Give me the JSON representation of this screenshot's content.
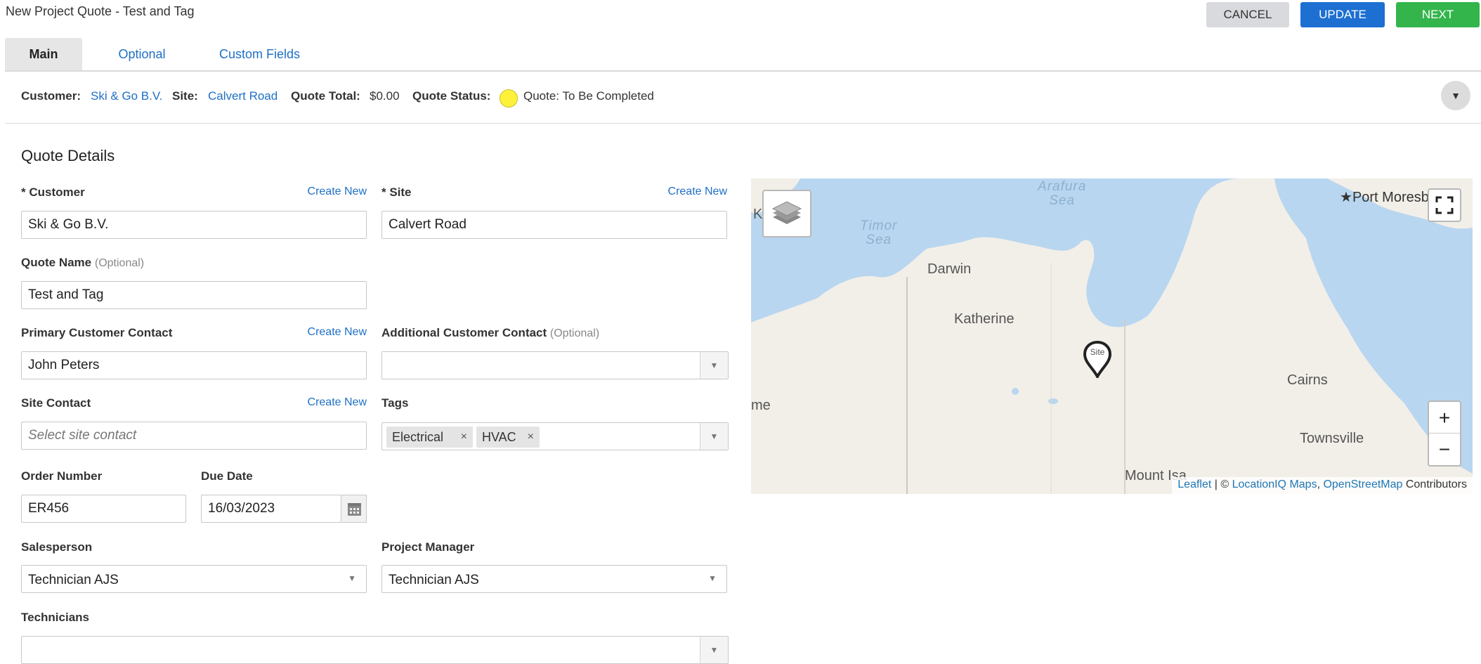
{
  "header": {
    "title": "New Project Quote - Test and Tag",
    "cancel_label": "CANCEL",
    "update_label": "UPDATE",
    "next_label": "NEXT"
  },
  "tabs": [
    {
      "label": "Main",
      "active": true
    },
    {
      "label": "Optional",
      "active": false
    },
    {
      "label": "Custom Fields",
      "active": false
    }
  ],
  "summary": {
    "customer_label": "Customer:",
    "customer_value": "Ski & Go B.V.",
    "site_label": "Site:",
    "site_value": "Calvert Road",
    "total_label": "Quote Total:",
    "total_value": "$0.00",
    "status_label": "Quote Status:",
    "status_value": "Quote: To Be Completed",
    "status_color": "#fff13a",
    "collapse_icon": "▼"
  },
  "section_title": "Quote Details",
  "form": {
    "create_new": "Create New",
    "customer_label": "* Customer",
    "customer_value": "Ski & Go B.V.",
    "site_label": "* Site",
    "site_value": "Calvert Road",
    "quote_name_label": "Quote Name",
    "optional_hint": "(Optional)",
    "quote_name_value": "Test and Tag",
    "primary_contact_label": "Primary Customer Contact",
    "primary_contact_value": "John Peters",
    "additional_contact_label": "Additional Customer Contact",
    "additional_contact_value": "",
    "site_contact_label": "Site Contact",
    "site_contact_placeholder": "Select site contact",
    "tags_label": "Tags",
    "tags": [
      "Electrical",
      "HVAC"
    ],
    "tag_remove": "×",
    "order_number_label": "Order Number",
    "order_number_value": "ER456",
    "due_date_label": "Due Date",
    "due_date_value": "16/03/2023",
    "salesperson_label": "Salesperson",
    "salesperson_value": "Technician AJS",
    "project_manager_label": "Project Manager",
    "project_manager_value": "Technician AJS",
    "technicians_label": "Technicians",
    "technicians_value": ""
  },
  "map": {
    "labels": {
      "darwin": "Darwin",
      "katherine": "Katherine",
      "cairns": "Cairns",
      "townsville": "Townsville",
      "mount_isa": "Mount Isa",
      "port_moresby": "Port Moresb",
      "k_edge": "K",
      "me_edge": "me"
    },
    "seas": {
      "arafura_1": "Arafura",
      "arafura_2": "Sea",
      "timor_1": "Timor",
      "timor_2": "Sea"
    },
    "marker_text": "Site",
    "zoom_in": "+",
    "zoom_out": "−",
    "attribution": {
      "leaflet": "Leaflet",
      "sep": " | © ",
      "locationiq": "LocationIQ Maps",
      "comma": ", ",
      "osm": "OpenStreetMap",
      "contributors": " Contributors"
    },
    "colors": {
      "water": "#b9d6f0",
      "land": "#f2efe9"
    }
  }
}
